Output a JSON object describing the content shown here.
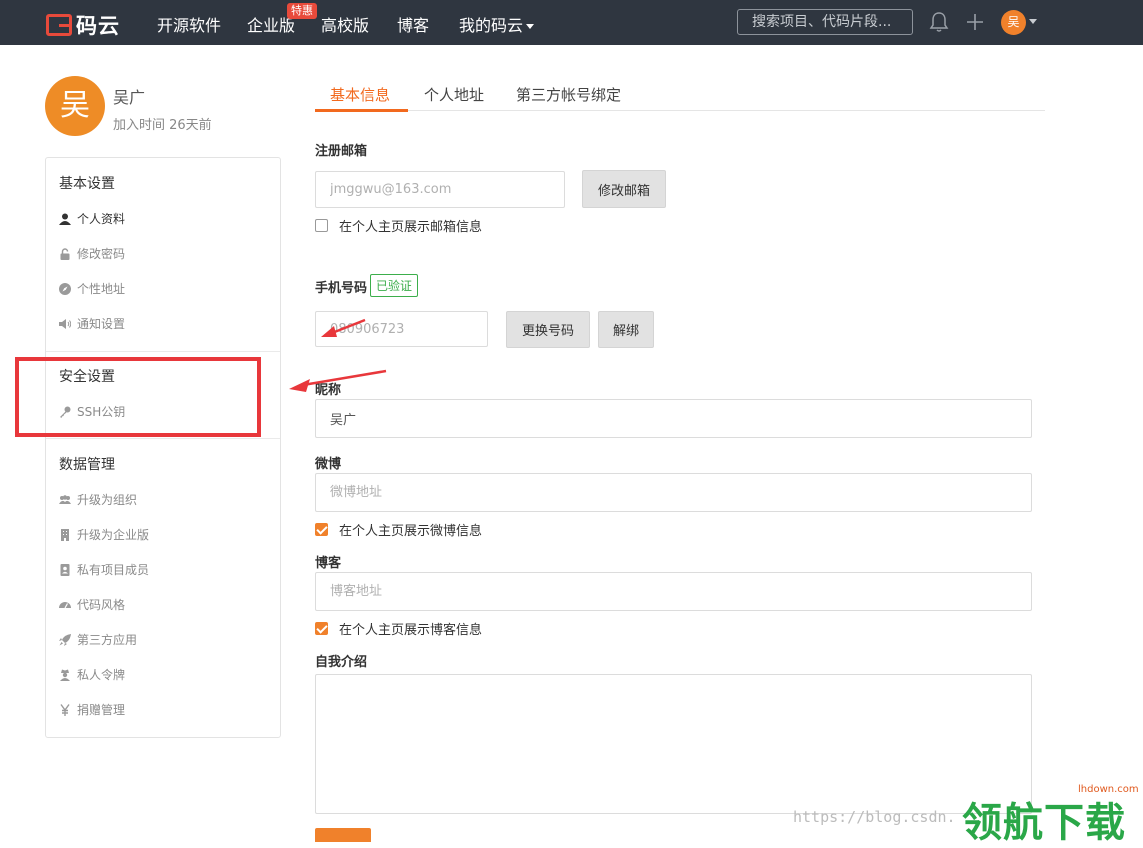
{
  "header": {
    "logo_text": "码云",
    "nav": [
      "开源软件",
      "企业版",
      "高校版",
      "博客",
      "我的码云"
    ],
    "badge": "特惠",
    "search_placeholder": "搜索项目、代码片段...",
    "avatar_char": "吴"
  },
  "profile": {
    "avatar_char": "吴",
    "name": "吴广",
    "joined": "加入时间 26天前"
  },
  "sidebar": {
    "sections": [
      {
        "title": "基本设置",
        "items": [
          "个人资料",
          "修改密码",
          "个性地址",
          "通知设置"
        ]
      },
      {
        "title": "安全设置",
        "items": [
          "SSH公钥"
        ]
      },
      {
        "title": "数据管理",
        "items": [
          "升级为组织",
          "升级为企业版",
          "私有项目成员",
          "代码风格",
          "第三方应用",
          "私人令牌",
          "捐赠管理"
        ]
      }
    ]
  },
  "tabs": [
    "基本信息",
    "个人地址",
    "第三方帐号绑定"
  ],
  "form": {
    "email_label": "注册邮箱",
    "email_placeholder": "jmggwu@163.com",
    "change_email": "修改邮箱",
    "show_email": "在个人主页展示邮箱信息",
    "phone_label": "手机号码",
    "verified": "已验证",
    "phone_placeholder": "080906723",
    "change_phone": "更换号码",
    "unbind": "解绑",
    "nickname_label": "昵称",
    "nickname_value": "吴广",
    "weibo_label": "微博",
    "weibo_placeholder": "微博地址",
    "show_weibo": "在个人主页展示微博信息",
    "blog_label": "博客",
    "blog_placeholder": "博客地址",
    "show_blog": "在个人主页展示博客信息",
    "intro_label": "自我介绍"
  },
  "watermark": {
    "url": "https://blog.csdn.",
    "logo": "领航下载",
    "small": "lhdown.com"
  },
  "colors": {
    "accent": "#f2691e",
    "nav_bg": "#2f3640",
    "verified": "#3cae4b",
    "annotation": "#e8373b"
  }
}
